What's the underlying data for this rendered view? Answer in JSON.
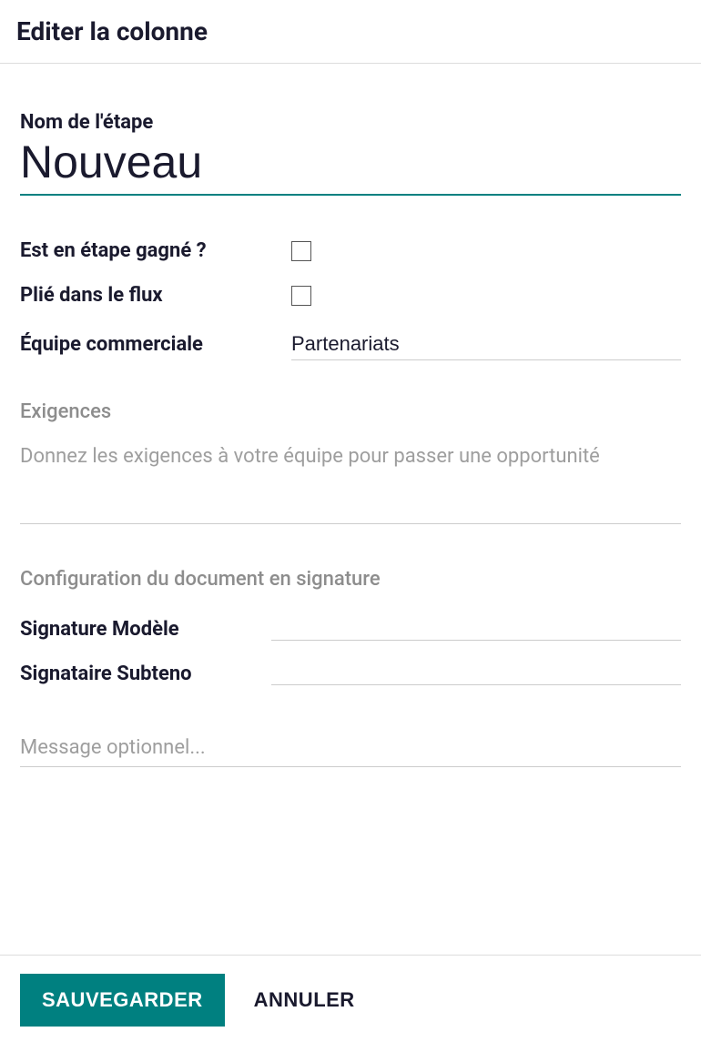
{
  "dialog": {
    "title": "Editer la colonne"
  },
  "stage": {
    "label": "Nom de l'étape",
    "value": "Nouveau"
  },
  "fields": {
    "is_won_label": "Est en étape gagné ?",
    "folded_label": "Plié dans le flux",
    "team_label": "Équipe commerciale",
    "team_value": "Partenariats"
  },
  "requirements": {
    "title": "Exigences",
    "placeholder": "Donnez les exigences à votre équipe pour passer une opportunité"
  },
  "signature": {
    "title": "Configuration du document en signature",
    "model_label": "Signature Modèle",
    "signatory_label": "Signataire Subteno",
    "optional_placeholder": "Message optionnel..."
  },
  "buttons": {
    "save": "SAUVEGARDER",
    "cancel": "ANNULER"
  }
}
